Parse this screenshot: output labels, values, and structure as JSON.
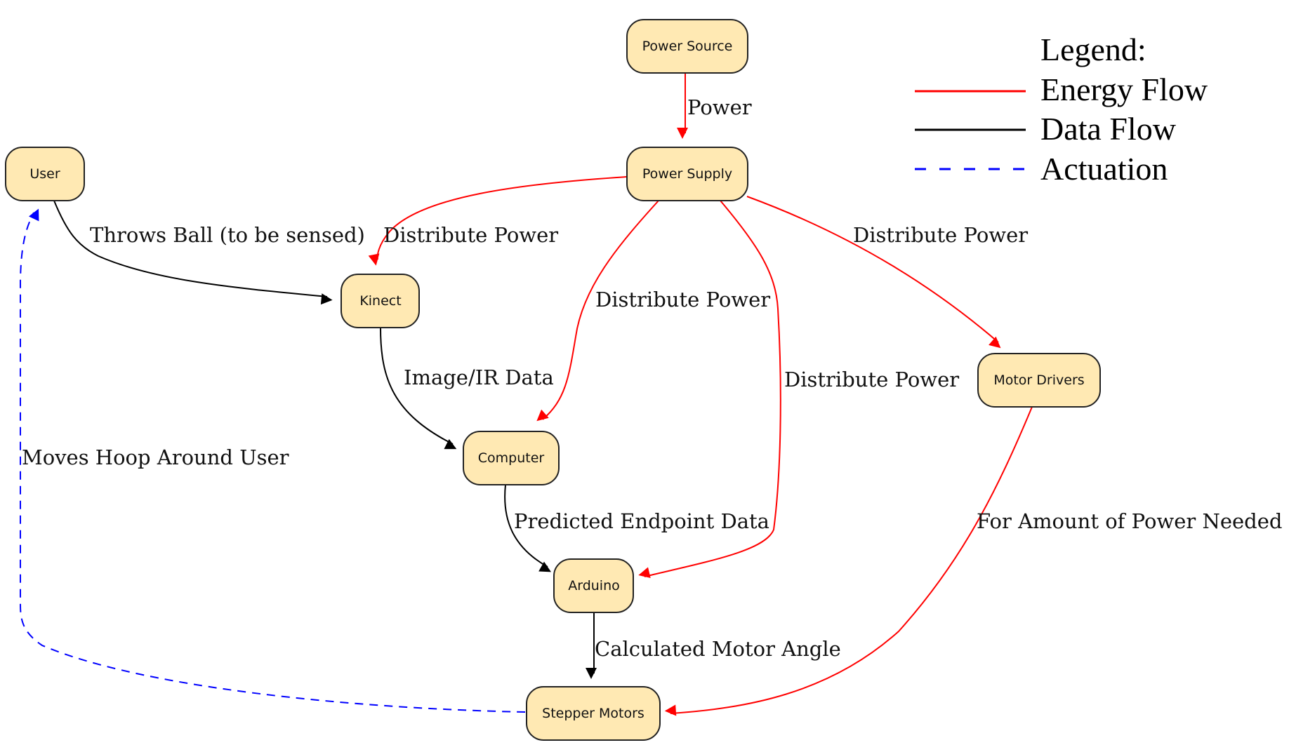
{
  "colors": {
    "node_fill": "#ffe9b3",
    "energy": "#ff0000",
    "data": "#000000",
    "actuation": "#0000ff"
  },
  "nodes": {
    "power_source": "Power Source",
    "power_supply": "Power Supply",
    "user": "User",
    "kinect": "Kinect",
    "computer": "Computer",
    "arduino": "Arduino",
    "motor_drivers": "Motor Drivers",
    "stepper_motors": "Stepper Motors"
  },
  "edges": [
    {
      "from": "Power Source",
      "to": "Power Supply",
      "type": "energy",
      "label": "Power"
    },
    {
      "from": "Power Supply",
      "to": "Kinect",
      "type": "energy",
      "label": "Distribute Power"
    },
    {
      "from": "Power Supply",
      "to": "Computer",
      "type": "energy",
      "label": "Distribute Power"
    },
    {
      "from": "Power Supply",
      "to": "Arduino",
      "type": "energy",
      "label": "Distribute Power"
    },
    {
      "from": "Power Supply",
      "to": "Motor Drivers",
      "type": "energy",
      "label": "Distribute Power"
    },
    {
      "from": "Motor Drivers",
      "to": "Stepper Motors",
      "type": "energy",
      "label": "For Amount of Power Needed"
    },
    {
      "from": "User",
      "to": "Kinect",
      "type": "data",
      "label": "Throws Ball (to be sensed)"
    },
    {
      "from": "Kinect",
      "to": "Computer",
      "type": "data",
      "label": "Image/IR Data"
    },
    {
      "from": "Computer",
      "to": "Arduino",
      "type": "data",
      "label": "Predicted Endpoint Data"
    },
    {
      "from": "Arduino",
      "to": "Stepper Motors",
      "type": "data",
      "label": "Calculated Motor Angle"
    },
    {
      "from": "Stepper Motors",
      "to": "User",
      "type": "actuation",
      "label": "Moves Hoop Around User"
    }
  ],
  "legend": {
    "title": "Legend:",
    "items": [
      {
        "label": "Energy Flow",
        "type": "energy"
      },
      {
        "label": "Data Flow",
        "type": "data"
      },
      {
        "label": "Actuation",
        "type": "actuation"
      }
    ]
  }
}
